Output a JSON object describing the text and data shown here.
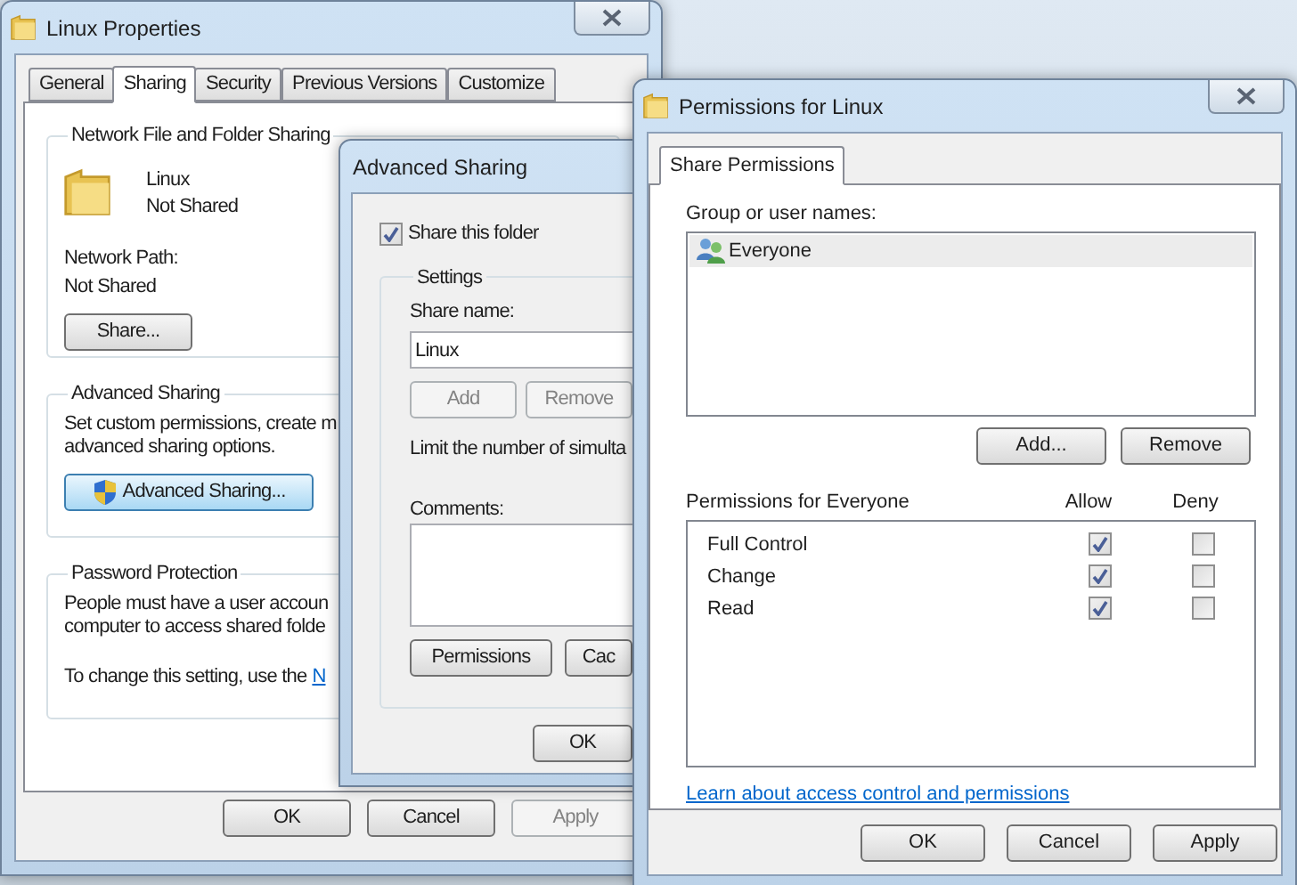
{
  "properties_window": {
    "title": "Linux Properties",
    "tabs": [
      {
        "label": "General",
        "selected": false
      },
      {
        "label": "Sharing",
        "selected": true
      },
      {
        "label": "Security",
        "selected": false
      },
      {
        "label": "Previous Versions",
        "selected": false
      },
      {
        "label": "Customize",
        "selected": false
      }
    ],
    "network_sharing": {
      "heading": "Network File and Folder Sharing",
      "folder_name": "Linux",
      "folder_status": "Not Shared",
      "path_label": "Network Path:",
      "path_value": "Not Shared",
      "share_button": "Share..."
    },
    "advanced_sharing": {
      "heading": "Advanced Sharing",
      "description": [
        "Set custom permissions, create m",
        "advanced sharing options."
      ],
      "button": {
        "label": "Advanced Sharing...",
        "highlighted": true
      }
    },
    "password_protection": {
      "heading": "Password Protection",
      "description": [
        "People must have a user accoun",
        "computer to access shared folde"
      ],
      "change_text": "To change this setting, use the",
      "change_link": "N"
    },
    "buttons": [
      {
        "label": "OK",
        "disabled": false
      },
      {
        "label": "Cancel",
        "disabled": false
      },
      {
        "label": "Apply",
        "disabled": true
      }
    ]
  },
  "advanced_sharing_dialog": {
    "title": "Advanced Sharing",
    "share_folder": {
      "label": "Share this folder",
      "checked": true
    },
    "settings": {
      "heading": "Settings",
      "share_name_label": "Share name:",
      "share_name": "Linux",
      "name_buttons": [
        {
          "label": "Add",
          "disabled": true
        },
        {
          "label": "Remove",
          "disabled": true
        }
      ],
      "limit_text": "Limit the number of simulta",
      "comments_label": "Comments:",
      "buttons": [
        {
          "label": "Permissions",
          "disabled": false
        },
        {
          "label": "Cac",
          "disabled": false
        }
      ]
    },
    "ok_button": "OK"
  },
  "permissions_dialog": {
    "title": "Permissions for Linux",
    "tabs": [
      {
        "label": "Share Permissions",
        "selected": true
      }
    ],
    "group_label": "Group or user names:",
    "users": [
      {
        "name": "Everyone",
        "selected": true
      }
    ],
    "user_buttons": [
      {
        "label": "Add...",
        "disabled": false
      },
      {
        "label": "Remove",
        "disabled": false
      }
    ],
    "permissions_label": "Permissions for Everyone",
    "allow_header": "Allow",
    "deny_header": "Deny",
    "permissions": [
      {
        "name": "Full Control",
        "allow": true,
        "deny": false
      },
      {
        "name": "Change",
        "allow": true,
        "deny": false
      },
      {
        "name": "Read",
        "allow": true,
        "deny": false
      }
    ],
    "link": "Learn about access control and permissions",
    "buttons": [
      {
        "label": "OK",
        "disabled": false
      },
      {
        "label": "Cancel",
        "disabled": false
      },
      {
        "label": "Apply",
        "disabled": false
      }
    ]
  }
}
